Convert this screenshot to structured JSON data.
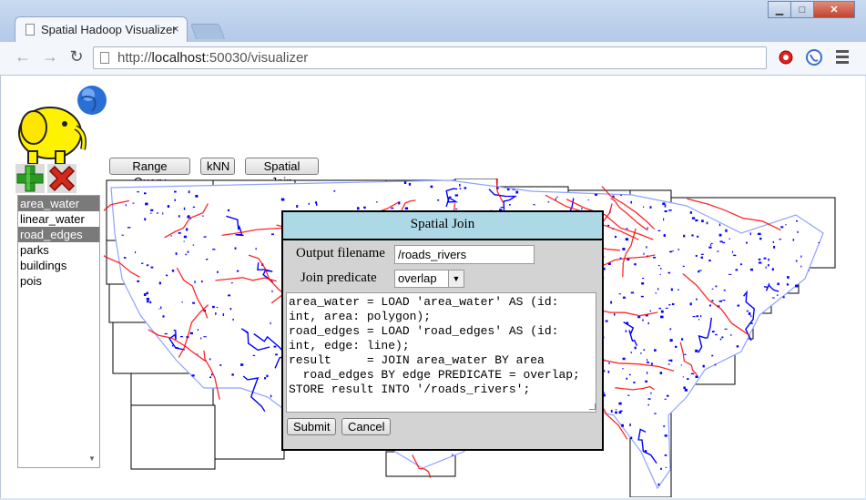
{
  "browser": {
    "tab_title": "Spatial Hadoop Visualizer",
    "tab_close": "×",
    "url_scheme": "http://",
    "url_host": "localhost",
    "url_rest": ":50030/visualizer",
    "window_controls": {
      "minimize": "▁",
      "maximize": "□",
      "close": "✕"
    }
  },
  "sidebar": {
    "layers": [
      {
        "label": "area_water",
        "selected": true
      },
      {
        "label": "linear_water",
        "selected": false
      },
      {
        "label": "road_edges",
        "selected": true
      },
      {
        "label": "parks",
        "selected": false
      },
      {
        "label": "buildings",
        "selected": false
      },
      {
        "label": "pois",
        "selected": false
      }
    ]
  },
  "toolbar": {
    "range_query": "Range Query",
    "knn": "kNN",
    "spatial_join": "Spatial Join"
  },
  "dialog": {
    "title": "Spatial Join",
    "output_label": "Output filename",
    "output_value": "/roads_rivers",
    "predicate_label": "Join predicate",
    "predicate_value": "overlap",
    "script": "area_water = LOAD 'area_water' AS (id:\nint, area: polygon);\nroad_edges = LOAD 'road_edges' AS (id:\nint, edge: line);\nresult     = JOIN area_water BY area\n  road_edges BY edge PREDICATE = overlap;\nSTORE result INTO '/roads_rivers';",
    "submit": "Submit",
    "cancel": "Cancel"
  },
  "colors": {
    "water": "#0000ff",
    "roads": "#ff0000",
    "dialog_title_bg": "#add8e6",
    "dialog_bg": "#d3d3d3"
  }
}
